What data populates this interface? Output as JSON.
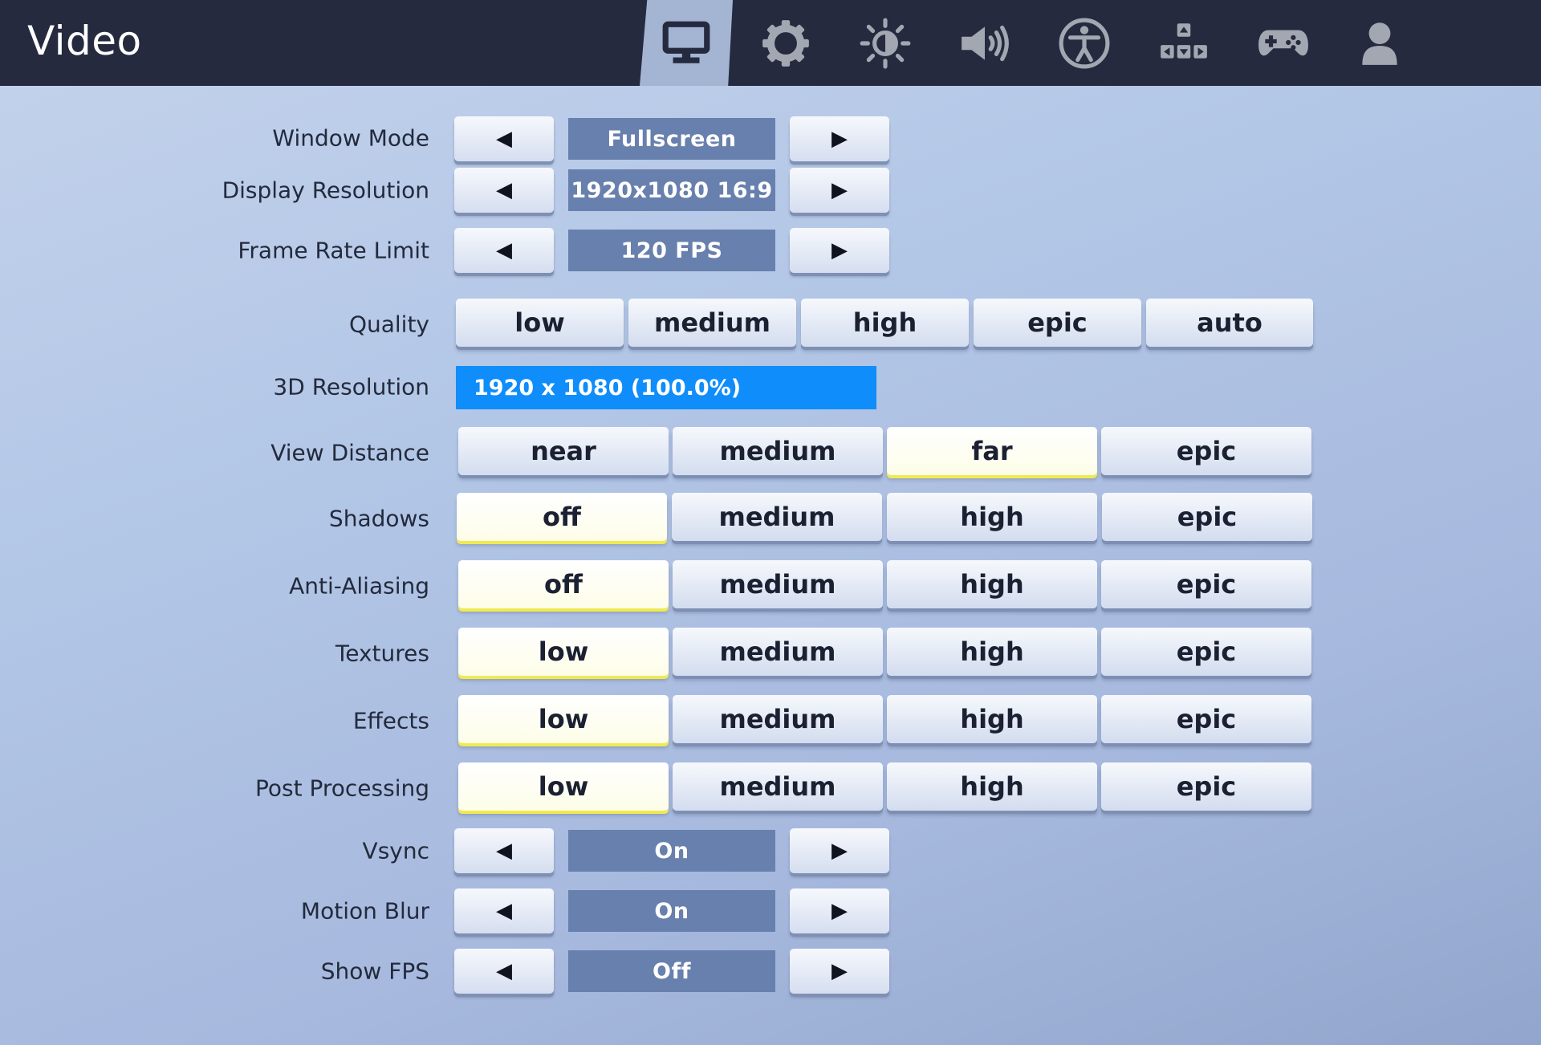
{
  "header": {
    "title": "Video",
    "tabs": [
      {
        "icon": "monitor-icon",
        "active": true
      },
      {
        "icon": "gear-icon",
        "active": false
      },
      {
        "icon": "brightness-icon",
        "active": false
      },
      {
        "icon": "speaker-icon",
        "active": false
      },
      {
        "icon": "accessibility-icon",
        "active": false
      },
      {
        "icon": "keyboard-keys-icon",
        "active": false
      },
      {
        "icon": "gamepad-icon",
        "active": false
      },
      {
        "icon": "user-icon",
        "active": false
      }
    ]
  },
  "arrows": {
    "left": "◀",
    "right": "▶"
  },
  "settings": {
    "window_mode": {
      "label": "Window Mode",
      "value": "Fullscreen"
    },
    "display_resolution": {
      "label": "Display Resolution",
      "value": "1920x1080 16:9"
    },
    "frame_rate_limit": {
      "label": "Frame Rate Limit",
      "value": "120 FPS"
    },
    "quality": {
      "label": "Quality",
      "options": [
        "low",
        "medium",
        "high",
        "epic",
        "auto"
      ]
    },
    "resolution_3d": {
      "label": "3D Resolution",
      "value": "1920 x 1080 (100.0%)",
      "fill_percent": 100.0
    },
    "view_distance": {
      "label": "View Distance",
      "options": [
        "near",
        "medium",
        "far",
        "epic"
      ],
      "selected": "far"
    },
    "shadows": {
      "label": "Shadows",
      "options": [
        "off",
        "medium",
        "high",
        "epic"
      ],
      "selected": "off"
    },
    "anti_aliasing": {
      "label": "Anti-Aliasing",
      "options": [
        "off",
        "medium",
        "high",
        "epic"
      ],
      "selected": "off"
    },
    "textures": {
      "label": "Textures",
      "options": [
        "low",
        "medium",
        "high",
        "epic"
      ],
      "selected": "low"
    },
    "effects": {
      "label": "Effects",
      "options": [
        "low",
        "medium",
        "high",
        "epic"
      ],
      "selected": "low"
    },
    "post_processing": {
      "label": "Post Processing",
      "options": [
        "low",
        "medium",
        "high",
        "epic"
      ],
      "selected": "low"
    },
    "vsync": {
      "label": "Vsync",
      "value": "On"
    },
    "motion_blur": {
      "label": "Motion Blur",
      "value": "On"
    },
    "show_fps": {
      "label": "Show FPS",
      "value": "Off"
    }
  },
  "colors": {
    "header_bg": "#252a3f",
    "value_box": "#6880ad",
    "resolution_bar": "#0f8dfa",
    "selected_underline": "#f0ea52"
  }
}
